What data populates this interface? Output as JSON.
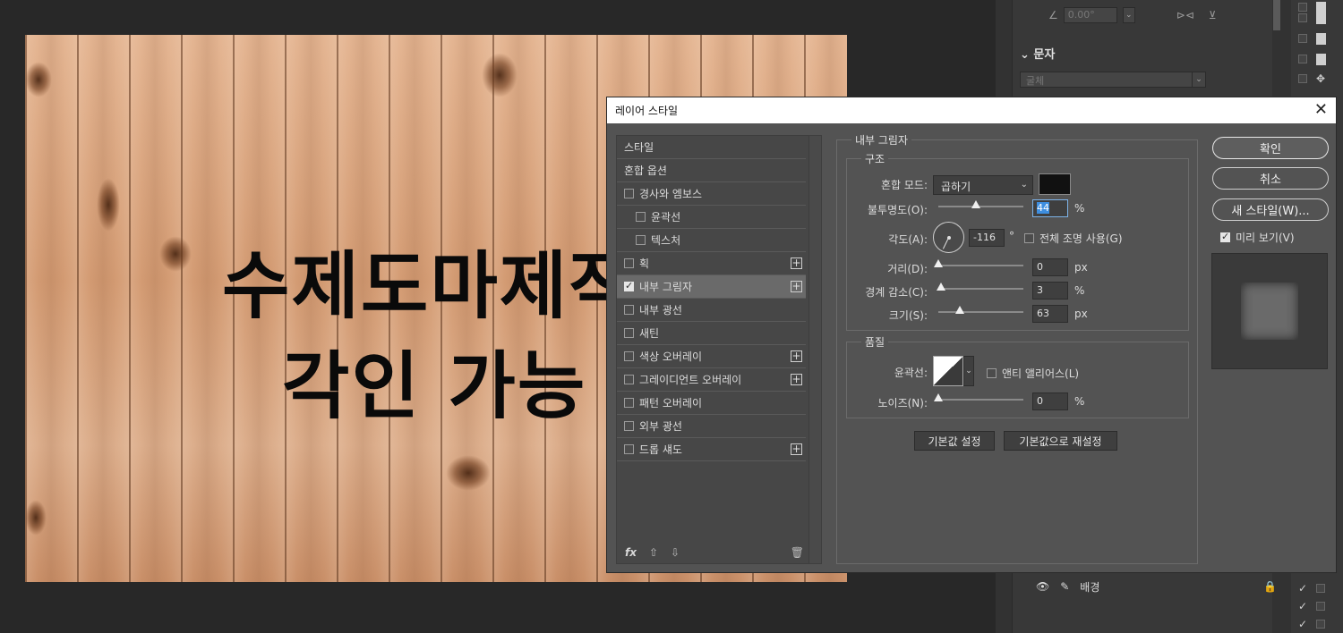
{
  "canvas": {
    "line1": "수제도마제작",
    "line2": "각인 가능"
  },
  "right_panel": {
    "angle_value": "0.00°",
    "section_label": "문자",
    "font_placeholder": "굴체",
    "layer_name": "배경"
  },
  "dialog": {
    "title": "레이어 스타일",
    "close": "✕",
    "styles_list": [
      {
        "label": "스타일",
        "checkbox": false,
        "checked": false,
        "plus": false,
        "sub": false
      },
      {
        "label": "혼합 옵션",
        "checkbox": false,
        "checked": false,
        "plus": false,
        "sub": false
      },
      {
        "label": "경사와 엠보스",
        "checkbox": true,
        "checked": false,
        "plus": false,
        "sub": false
      },
      {
        "label": "윤곽선",
        "checkbox": true,
        "checked": false,
        "plus": false,
        "sub": true
      },
      {
        "label": "텍스처",
        "checkbox": true,
        "checked": false,
        "plus": false,
        "sub": true
      },
      {
        "label": "획",
        "checkbox": true,
        "checked": false,
        "plus": true,
        "sub": false
      },
      {
        "label": "내부 그림자",
        "checkbox": true,
        "checked": true,
        "plus": true,
        "sub": false,
        "active": true
      },
      {
        "label": "내부 광선",
        "checkbox": true,
        "checked": false,
        "plus": false,
        "sub": false
      },
      {
        "label": "새틴",
        "checkbox": true,
        "checked": false,
        "plus": false,
        "sub": false
      },
      {
        "label": "색상 오버레이",
        "checkbox": true,
        "checked": false,
        "plus": true,
        "sub": false
      },
      {
        "label": "그레이디언트 오버레이",
        "checkbox": true,
        "checked": false,
        "plus": true,
        "sub": false
      },
      {
        "label": "패턴 오버레이",
        "checkbox": true,
        "checked": false,
        "plus": false,
        "sub": false
      },
      {
        "label": "외부 광선",
        "checkbox": true,
        "checked": false,
        "plus": false,
        "sub": false
      },
      {
        "label": "드롭 섀도",
        "checkbox": true,
        "checked": false,
        "plus": true,
        "sub": false
      }
    ],
    "footer": {
      "fx": "fx",
      "up": "⇧",
      "down": "⇩",
      "trash": "🗑"
    },
    "panel": {
      "title": "내부 그림자",
      "structure": {
        "legend": "구조",
        "blend_mode_label": "혼합 모드:",
        "blend_mode_value": "곱하기",
        "shadow_color": "#111111",
        "opacity_label": "불투명도(O):",
        "opacity_value": "44",
        "opacity_level": 0.44,
        "opacity_unit": "%",
        "angle_label": "각도(A):",
        "angle_value": "-116",
        "angle_unit": "°",
        "global_light_label": "전체 조명 사용(G)",
        "global_light_checked": false,
        "distance_label": "거리(D):",
        "distance_value": "0",
        "distance_level": 0,
        "distance_unit": "px",
        "choke_label": "경계 감소(C):",
        "choke_value": "3",
        "choke_level": 0.03,
        "choke_unit": "%",
        "size_label": "크기(S):",
        "size_value": "63",
        "size_level": 0.25,
        "size_unit": "px"
      },
      "quality": {
        "legend": "품질",
        "contour_label": "윤곽선:",
        "antialias_label": "앤티 앨리어스(L)",
        "antialias_checked": false,
        "noise_label": "노이즈(N):",
        "noise_value": "0",
        "noise_level": 0,
        "noise_unit": "%"
      },
      "set_default": "기본값 설정",
      "reset_default": "기본값으로 재설정"
    },
    "buttons": {
      "ok": "확인",
      "cancel": "취소",
      "new_style": "새 스타일(W)...",
      "preview_label": "미리 보기(V)",
      "preview_checked": true
    }
  }
}
